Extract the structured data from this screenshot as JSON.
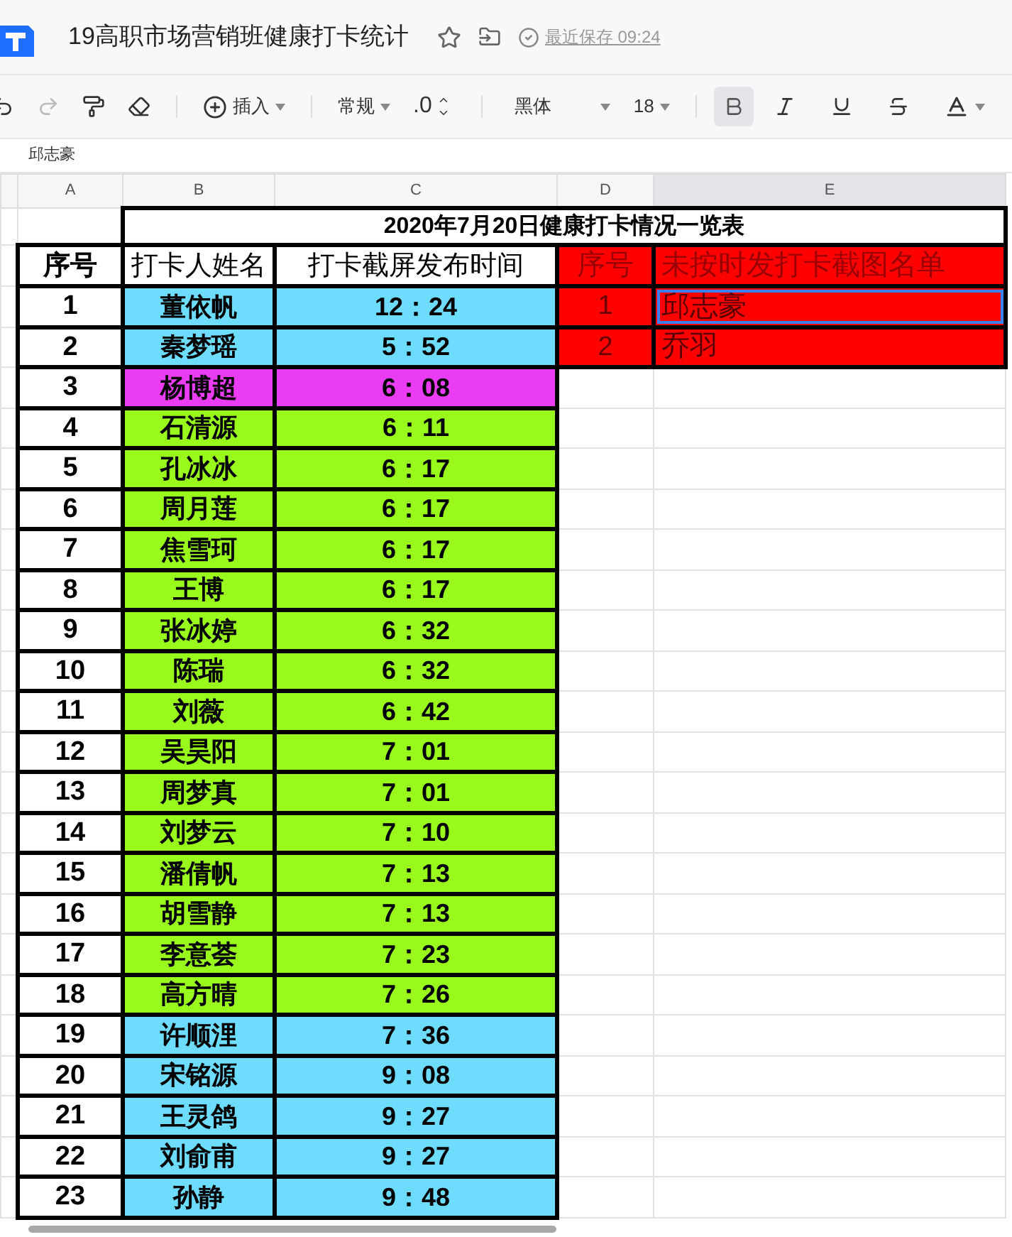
{
  "document": {
    "title": "19高职市场营销班健康打卡统计",
    "last_saved": "最近保存 09:24"
  },
  "toolbar": {
    "insert": "插入",
    "number_format": "常规",
    "decimal": ".0",
    "font": "黑体",
    "font_size": "18",
    "bold_on": true
  },
  "formula_bar": {
    "value": "邱志豪"
  },
  "columns": [
    {
      "label": "A",
      "selected": false
    },
    {
      "label": "B",
      "selected": false
    },
    {
      "label": "C",
      "selected": false
    },
    {
      "label": "D",
      "selected": false
    },
    {
      "label": "E",
      "selected": true
    }
  ],
  "sheet": {
    "title": "2020年7月20日健康打卡情况一览表",
    "headers": [
      "序号",
      "打卡人姓名",
      "打卡截屏发布时间"
    ],
    "late_headers": [
      "序号",
      "未按时发打卡截图名单"
    ],
    "late": [
      {
        "no": "1",
        "name": "邱志豪",
        "selected": true
      },
      {
        "no": "2",
        "name": "乔羽",
        "selected": false
      }
    ],
    "rows": [
      {
        "no": "1",
        "name": "董依帆",
        "time": "12：24",
        "color": "#6ddcfd"
      },
      {
        "no": "2",
        "name": "秦梦瑶",
        "time": "5：52",
        "color": "#6ddcfd"
      },
      {
        "no": "3",
        "name": "杨博超",
        "time": "6：08",
        "color": "#e93cf3"
      },
      {
        "no": "4",
        "name": "石清源",
        "time": "6：11",
        "color": "#99f81c"
      },
      {
        "no": "5",
        "name": "孔冰冰",
        "time": "6：17",
        "color": "#99f81c"
      },
      {
        "no": "6",
        "name": "周月莲",
        "time": "6：17",
        "color": "#99f81c"
      },
      {
        "no": "7",
        "name": "焦雪珂",
        "time": "6：17",
        "color": "#99f81c"
      },
      {
        "no": "8",
        "name": "王博",
        "time": "6：17",
        "color": "#99f81c"
      },
      {
        "no": "9",
        "name": "张冰婷",
        "time": "6：32",
        "color": "#99f81c"
      },
      {
        "no": "10",
        "name": "陈瑞",
        "time": "6：32",
        "color": "#99f81c"
      },
      {
        "no": "11",
        "name": "刘薇",
        "time": "6：42",
        "color": "#99f81c"
      },
      {
        "no": "12",
        "name": "吴昊阳",
        "time": "7：01",
        "color": "#99f81c"
      },
      {
        "no": "13",
        "name": "周梦真",
        "time": "7：01",
        "color": "#99f81c"
      },
      {
        "no": "14",
        "name": "刘梦云",
        "time": "7：10",
        "color": "#99f81c"
      },
      {
        "no": "15",
        "name": "潘倩帆",
        "time": "7：13",
        "color": "#99f81c"
      },
      {
        "no": "16",
        "name": "胡雪静",
        "time": "7：13",
        "color": "#99f81c"
      },
      {
        "no": "17",
        "name": "李意荟",
        "time": "7：23",
        "color": "#99f81c"
      },
      {
        "no": "18",
        "name": "高方晴",
        "time": "7：26",
        "color": "#99f81c"
      },
      {
        "no": "19",
        "name": "许顺浬",
        "time": "7：36",
        "color": "#6ddcfd"
      },
      {
        "no": "20",
        "name": "宋铭源",
        "time": "9：08",
        "color": "#6ddcfd"
      },
      {
        "no": "21",
        "name": "王灵鸽",
        "time": "9：27",
        "color": "#6ddcfd"
      },
      {
        "no": "22",
        "name": "刘俞甫",
        "time": "9：27",
        "color": "#6ddcfd"
      },
      {
        "no": "23",
        "name": "孙静",
        "time": "9：48",
        "color": "#6ddcfd"
      }
    ]
  }
}
